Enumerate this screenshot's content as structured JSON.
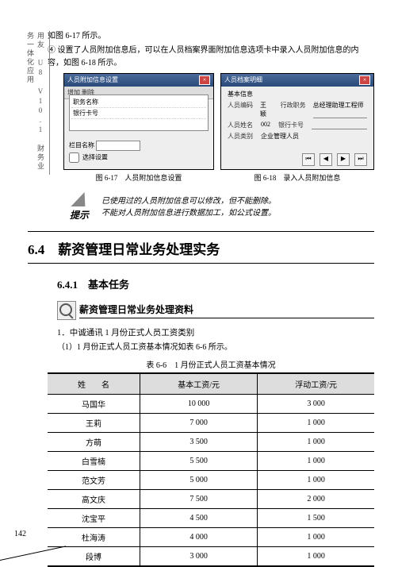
{
  "side_text": "用友 U8 V10.1 财务业务一体化应用",
  "intro": {
    "line1": "如图 6-17 所示。",
    "line2": "④ 设置了人员附加信息后，可以在人员档案界面附加信息选项卡中录入人员附加信息的内容，如图 6-18 所示。"
  },
  "fig617": {
    "title": "人员附加信息设置",
    "toolbar": "增加  删除",
    "row1": "职务名称",
    "row2": "银行卡号",
    "footer_label": "栏目名称",
    "chk_label": "选择设置",
    "caption": "图 6-17　人员附加信息设置"
  },
  "fig618": {
    "title": "人员档案明细",
    "tab": "基本信息",
    "row_code_l": "人员编码",
    "row_code_v": "王颖",
    "row_name_l": "人员姓名",
    "row_name_v": "002",
    "row_class_l": "人员类别",
    "row_class_v": "企业管理人员",
    "row_jobnum_l": "行政职务",
    "row_jobnum_v": "总经理助理工程师",
    "row_card_l": "银行卡号",
    "caption": "图 6-18　录入人员附加信息"
  },
  "tip": {
    "label": "提示",
    "l1": "已使用过的人员附加信息可以修改，但不能删除。",
    "l2": "不能对人员附加信息进行数据加工，如公式设置。"
  },
  "h64": "6.4　薪资管理日常业务处理实务",
  "h641": "6.4.1　基本任务",
  "material": "薪资管理日常业务处理资料",
  "sub1": "1．中诚通讯 1 月份正式人员工资类别",
  "sub2": "（1）1 月份正式人员工资基本情况如表 6-6 所示。",
  "table": {
    "caption": "表 6-6　1 月份正式人员工资基本情况",
    "headers": [
      "姓　　名",
      "基本工资/元",
      "浮动工资/元"
    ],
    "rows": [
      [
        "马国华",
        "10 000",
        "3 000"
      ],
      [
        "王莉",
        "7 000",
        "1 000"
      ],
      [
        "方萌",
        "3 500",
        "1 000"
      ],
      [
        "白雪楠",
        "5 500",
        "1 000"
      ],
      [
        "范文芳",
        "5 000",
        "1 000"
      ],
      [
        "高文庆",
        "7 500",
        "2 000"
      ],
      [
        "沈宝平",
        "4 500",
        "1 500"
      ],
      [
        "杜海涛",
        "4 000",
        "1 000"
      ],
      [
        "段博",
        "3 000",
        "1 000"
      ]
    ]
  },
  "page_num": "142"
}
